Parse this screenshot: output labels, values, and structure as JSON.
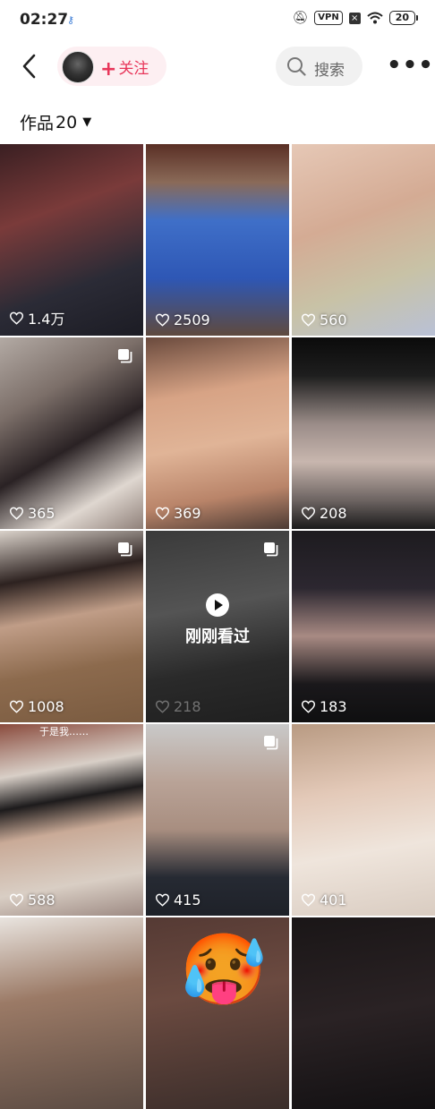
{
  "status_bar": {
    "time": "02:27",
    "vpn": "VPN",
    "battery": "20"
  },
  "header": {
    "follow_label": "关注",
    "search_label": "搜索"
  },
  "works": {
    "label": "作品",
    "count": "20"
  },
  "viewed_label": "刚刚看过",
  "tiles": [
    {
      "likes": "1.4万",
      "multi": false,
      "bg": "linear-gradient(160deg,#3a1f22 0%,#7a3b3a 35%,#2b2b36 70%,#1c1c24 100%)"
    },
    {
      "likes": "2509",
      "multi": false,
      "bg": "linear-gradient(180deg,#5a2f25 0%,#8a6a58 20%,#3f6fc8 40%,#2e57b5 70%,#5f4a3e 100%)"
    },
    {
      "likes": "560",
      "multi": false,
      "bg": "linear-gradient(160deg,#e6c8b6 0%,#d4ab94 40%,#c8c2a6 70%,#b9c1d6 100%)"
    },
    {
      "likes": "365",
      "multi": true,
      "bg": "linear-gradient(150deg,#b3aaa4 0%,#7c6f69 30%,#2a2224 55%,#dfd7d0 80%,#8f8079 100%)"
    },
    {
      "likes": "369",
      "multi": false,
      "bg": "linear-gradient(170deg,#6a4a3d 0%,#d7a385 30%,#e0b497 55%,#b98469 80%,#4b3a33 100%)"
    },
    {
      "likes": "208",
      "multi": false,
      "bg": "linear-gradient(180deg,#0b0b0b 0%,#1e1e1e 20%,#9a8c88 45%,#c8b6ae 65%,#6d6462 85%,#1a1a1a 100%)"
    },
    {
      "likes": "1008",
      "multi": true,
      "bg": "linear-gradient(170deg,#d9d1c9 0%,#2d2220 25%,#c09d87 45%,#8c6a4d 70%,#7a5b40 100%)"
    },
    {
      "likes": "218",
      "multi": true,
      "viewed": true,
      "bg": "linear-gradient(170deg,#3a3a3a 0%,#545454 40%,#2a2a2a 70%,#1f1f1f 100%)"
    },
    {
      "likes": "183",
      "multi": false,
      "bg": "linear-gradient(180deg,#1d1b1f 0%,#2c2730 30%,#a88a83 55%,#1a181b 80%,#0f0f10 100%)"
    },
    {
      "likes": "588",
      "multi": false,
      "caption": "于是我……",
      "bg": "linear-gradient(170deg,#8a4b3d 0%,#d8cfc7 25%,#1d1b1c 40%,#c9aa97 55%,#d9cec4 80%,#9d8a83 100%)"
    },
    {
      "likes": "415",
      "multi": true,
      "bg": "linear-gradient(180deg,#c9c9c9 0%,#b9a397 30%,#a88e80 55%,#262a33 80%,#1e2128 100%)"
    },
    {
      "likes": "401",
      "multi": false,
      "bg": "linear-gradient(170deg,#b89a82 0%,#e3c9b8 35%,#efe5dc 65%,#d9ccc1 100%)"
    },
    {
      "likes": "",
      "multi": false,
      "bg": "linear-gradient(170deg,#e9e4df 0%,#9b7a66 40%,#5a4a42 100%)"
    },
    {
      "likes": "",
      "multi": false,
      "emoji": "🥵",
      "bg": "linear-gradient(170deg,#553a34 0%,#6b4a40 40%,#3a2d2a 100%)"
    },
    {
      "likes": "",
      "multi": false,
      "bg": "linear-gradient(170deg,#1a1617 0%,#2a2224 50%,#121012 100%)"
    }
  ]
}
